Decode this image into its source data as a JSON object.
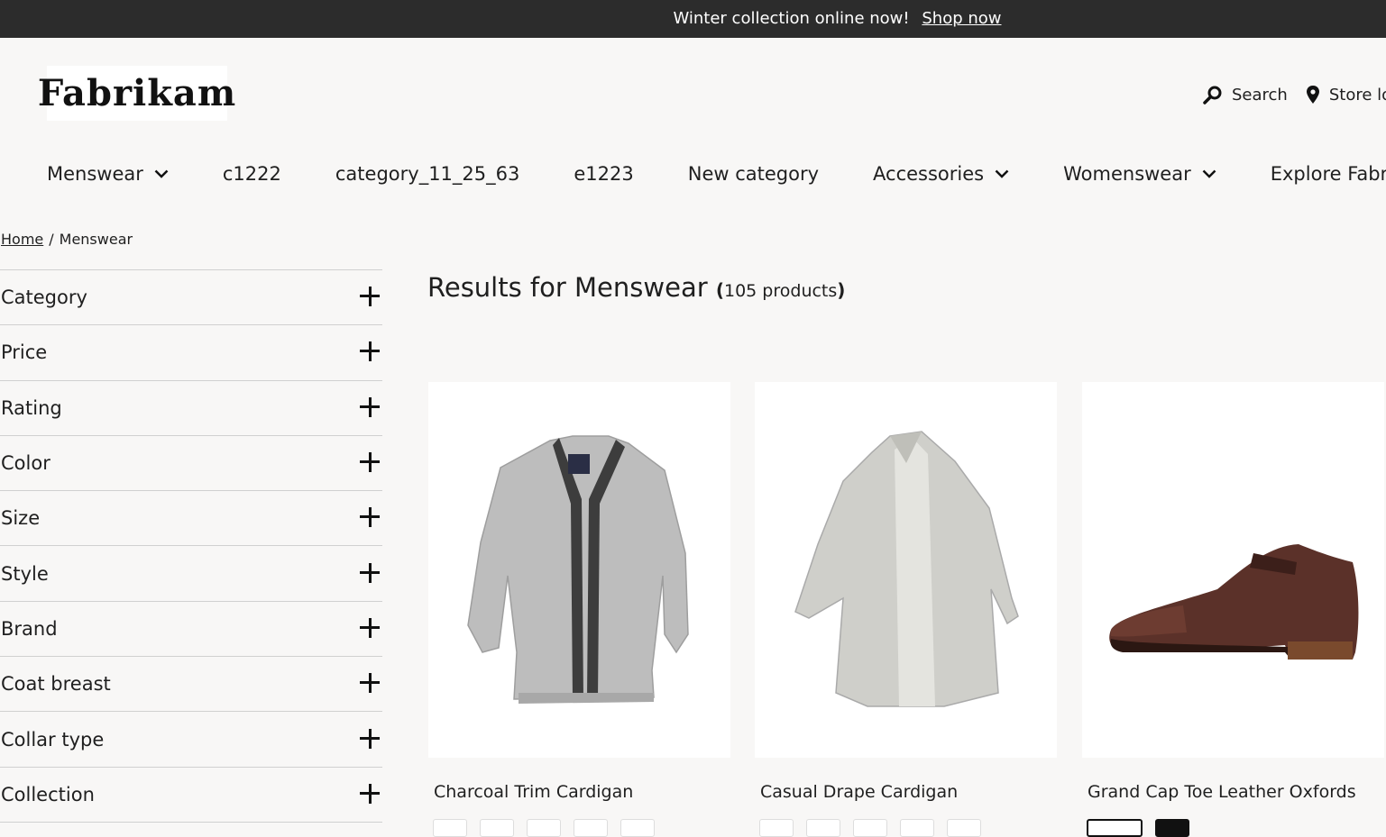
{
  "promo": {
    "text": "Winter collection online now!",
    "link": "Shop now"
  },
  "logo": {
    "text": "Fabrikam"
  },
  "utility": {
    "search": "Search",
    "store": "Store lo"
  },
  "nav": [
    {
      "label": "Menswear",
      "dropdown": true
    },
    {
      "label": "c1222",
      "dropdown": false
    },
    {
      "label": "category_11_25_63",
      "dropdown": false
    },
    {
      "label": "e1223",
      "dropdown": false
    },
    {
      "label": "New category",
      "dropdown": false
    },
    {
      "label": "Accessories",
      "dropdown": true
    },
    {
      "label": "Womenswear",
      "dropdown": true
    },
    {
      "label": "Explore Fabrikam",
      "dropdown": true
    }
  ],
  "breadcrumb": {
    "home": "Home",
    "separator": "/",
    "current": "Menswear"
  },
  "filters": [
    "Category",
    "Price",
    "Rating",
    "Color",
    "Size",
    "Style",
    "Brand",
    "Coat breast",
    "Collar type",
    "Collection"
  ],
  "results": {
    "prefix": "Results for Menswear",
    "open": "(",
    "count": "105 products",
    "close": ")"
  },
  "products": [
    {
      "name": "Charcoal Trim Cardigan",
      "image": "grey-cardigan-image"
    },
    {
      "name": "Casual Drape Cardigan",
      "image": "drape-cardigan-image"
    },
    {
      "name": "Grand Cap Toe Leather Oxfords",
      "image": "brown-oxford-shoe-image"
    }
  ]
}
